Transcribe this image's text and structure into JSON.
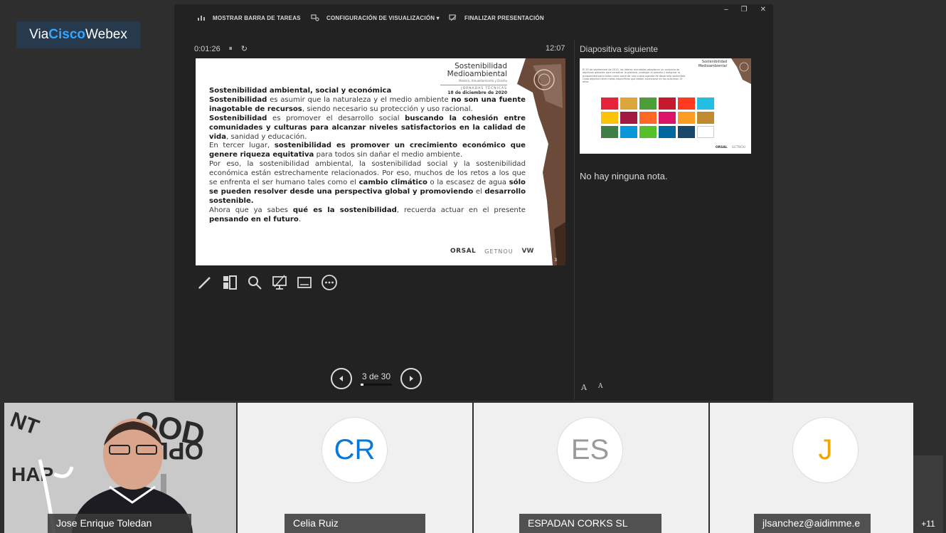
{
  "webex_badge": {
    "prefix": "Via ",
    "brand": "Cisco",
    "suffix": "Webex"
  },
  "toolbar": {
    "show_taskbar": "MOSTRAR BARRA DE TAREAS",
    "display_settings": "CONFIGURACIÓN DE VISUALIZACIÓN ▾",
    "end_presentation": "FINALIZAR PRESENTACIÓN"
  },
  "window_controls": {
    "minimize": "–",
    "restore": "❐",
    "close": "✕"
  },
  "timer": {
    "elapsed": "0:01:26",
    "pause_icon": "⏸",
    "reset_icon": "↻"
  },
  "clock": "12:07",
  "next_slide_label": "Diapositiva siguiente",
  "slide": {
    "header_line1": "Sostenibilidad",
    "header_line2": "Medioambiental",
    "header_sub": "Madera, Amueblamiento y Diseño",
    "header_event": "JORNADAS TÉCNICAS",
    "header_date": "18 de diciembre de 2020",
    "title": "Sostenibilidad ambiental, social y económica",
    "p1_b1": "Sostenibilidad",
    "p1_t1": " es asumir que la naturaleza y el medio ambiente ",
    "p1_b2": "no son una fuente inagotable de recursos",
    "p1_t2": ", siendo necesario su protección y uso racional.",
    "p2_b1": "Sostenibilidad",
    "p2_t1": " es promover el desarrollo social ",
    "p2_b2": "buscando la cohesión entre comunidades y culturas para alcanzar niveles satisfactorios en la calidad de vida",
    "p2_t2": ", sanidad y educación.",
    "p3_t1": "En tercer lugar, ",
    "p3_b1": "sostenibilidad es promover un crecimiento económico que genere riqueza equitativa",
    "p3_t2": " para todos sin dañar el medio ambiente.",
    "p4_t1": "Por eso, la sostenibilidad ambiental, la sostenibilidad social y la sostenibilidad económica están estrechamente relacionados. Por eso, muchos de los retos a los que se enfrenta el ser humano tales como el ",
    "p4_b1": "cambio climático",
    "p4_t2": " o la escasez de agua ",
    "p4_b2": "sólo se pueden resolver desde una perspectiva global y promoviendo",
    "p4_t3": " el ",
    "p4_b3": "desarrollo sostenible.",
    "p5_t1": "Ahora que ya sabes ",
    "p5_b1": "qué es la sostenibilidad",
    "p5_t2": ", recuerda actuar en el presente ",
    "p5_b2": "pensando en el futuro",
    "p5_t3": ".",
    "logo_orsal": "ORSAL",
    "logo_getnou": "GETNOU",
    "logo_vw": "VW",
    "number": "3"
  },
  "next_slide": {
    "title1": "Sostenibilidad",
    "title2": "Medioambiental",
    "text": "El 25 de septiembre de 2015, los líderes mundiales adoptaron un conjunto de objetivos globales para erradicar la pobreza, proteger el planeta y asegurar la prosperidad para todos como parte de una nueva agenda de desarrollo sostenible. Cada objetivo tiene metas específicas que deben alcanzarse en los próximos 15 años.",
    "sdg_colors": [
      "#e5243b",
      "#dda63a",
      "#4c9f38",
      "#c5192d",
      "#ff3a21",
      "#26bde2",
      "#fcc30b",
      "#a21942",
      "#fd6925",
      "#dd1367",
      "#fd9d24",
      "#bf8b2e",
      "#3f7e44",
      "#0a97d9",
      "#56c02b",
      "#00689d",
      "#19486a",
      "#ffffff"
    ],
    "logo_orsal": "ORSAL",
    "logo_getnou": "GETNOU"
  },
  "notes": "No hay ninguna nota.",
  "font_controls": {
    "increase": "A",
    "decrease": "A"
  },
  "navigation": {
    "counter": "3 de 30",
    "progress": 0.1
  },
  "participants": [
    {
      "name": "Jose Enrique Toledan"
    },
    {
      "name": "Celia Ruiz",
      "initials": "CR",
      "color": "#0a78d7"
    },
    {
      "name": "ESPADAN CORKS SL",
      "initials": "ES",
      "color": "#9a9a9a"
    },
    {
      "name": "jlsanchez@aidimme.e",
      "initials": "J",
      "color": "#f0a500"
    }
  ],
  "more_participants": "+11"
}
